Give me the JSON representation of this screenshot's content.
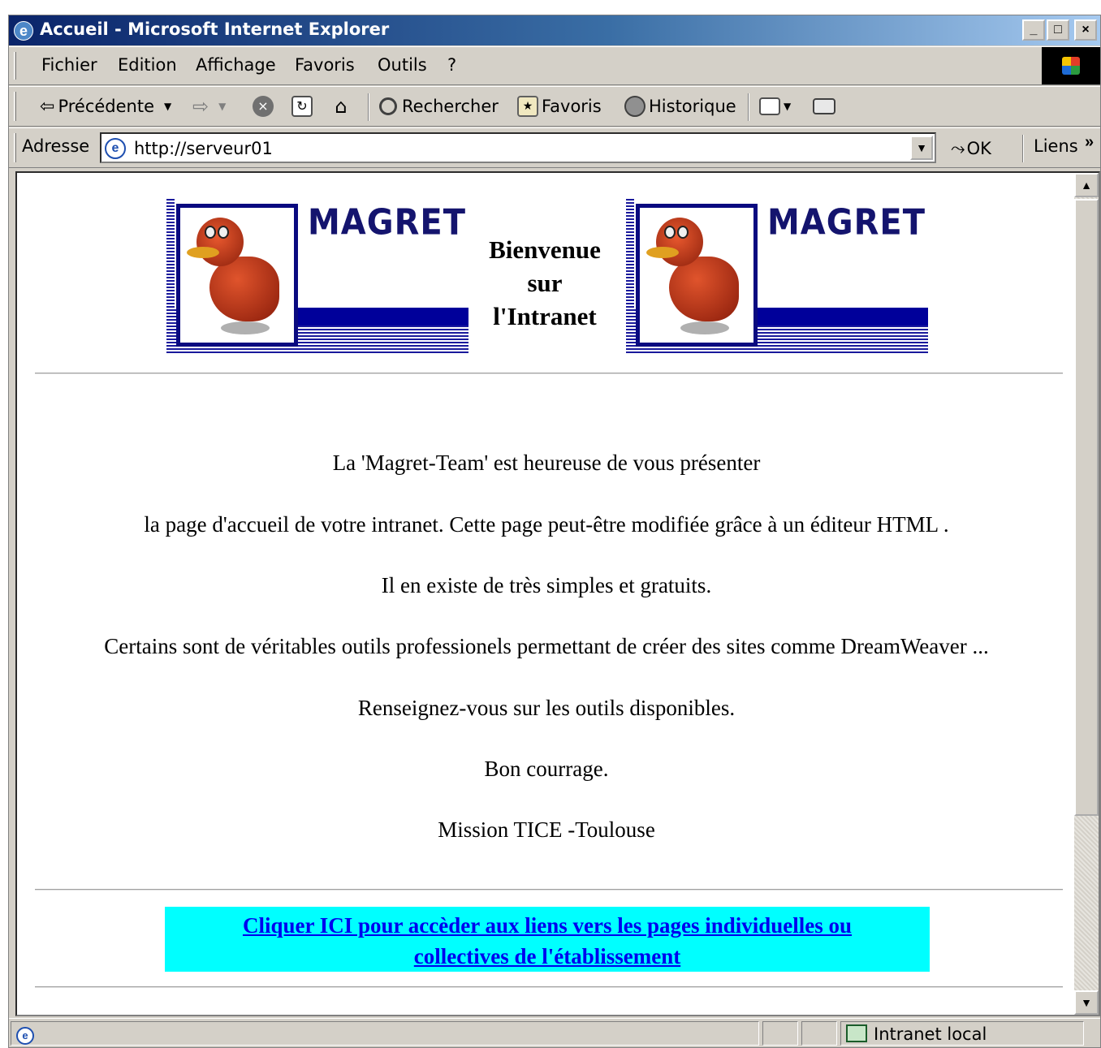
{
  "window": {
    "title": "Accueil - Microsoft Internet Explorer",
    "controls": {
      "minimize": "_",
      "maximize": "□",
      "close": "×"
    }
  },
  "menu": [
    "Fichier",
    "Edition",
    "Affichage",
    "Favoris",
    "Outils",
    "?"
  ],
  "toolbar": {
    "back": "Précédente",
    "search": "Rechercher",
    "favorites": "Favoris",
    "history": "Historique"
  },
  "address": {
    "label": "Adresse",
    "url": "http://serveur01",
    "go": "OK",
    "links": "Liens",
    "links_more": "»"
  },
  "page": {
    "logo_text": "MAGRET",
    "welcome": [
      "Bienvenue",
      "sur",
      "l'Intranet"
    ],
    "paragraphs": [
      "La 'Magret-Team' est heureuse de vous présenter",
      "la page d'accueil de votre intranet. Cette page  peut-être modifiée grâce à un éditeur HTML .",
      "Il en existe de très simples et gratuits.",
      "Certains sont de véritables outils professionels permettant de créer des sites comme DreamWeaver ...",
      "Renseignez-vous sur les outils disponibles.",
      "Bon courrage.",
      "Mission TICE -Toulouse"
    ],
    "cta_lines": [
      "Cliquer ICI pour accèder aux liens vers les pages individuelles ou",
      "collectives de l'établissement"
    ],
    "cta_bg": "#00ffff",
    "link_color": "#0000ee"
  },
  "status": {
    "zone": "Intranet local"
  },
  "colors": {
    "titlebar_start": "#0a246a",
    "chrome": "#d4d0c8",
    "logo_blue": "#00009a"
  },
  "icons": [
    "ie-logo-icon",
    "back-arrow-icon",
    "forward-arrow-icon",
    "stop-icon",
    "refresh-icon",
    "home-icon",
    "search-icon",
    "favorites-icon",
    "history-icon",
    "mail-icon",
    "print-icon",
    "windows-logo-icon",
    "go-arrow-icon",
    "intranet-zone-icon",
    "duck-mascot-icon"
  ]
}
